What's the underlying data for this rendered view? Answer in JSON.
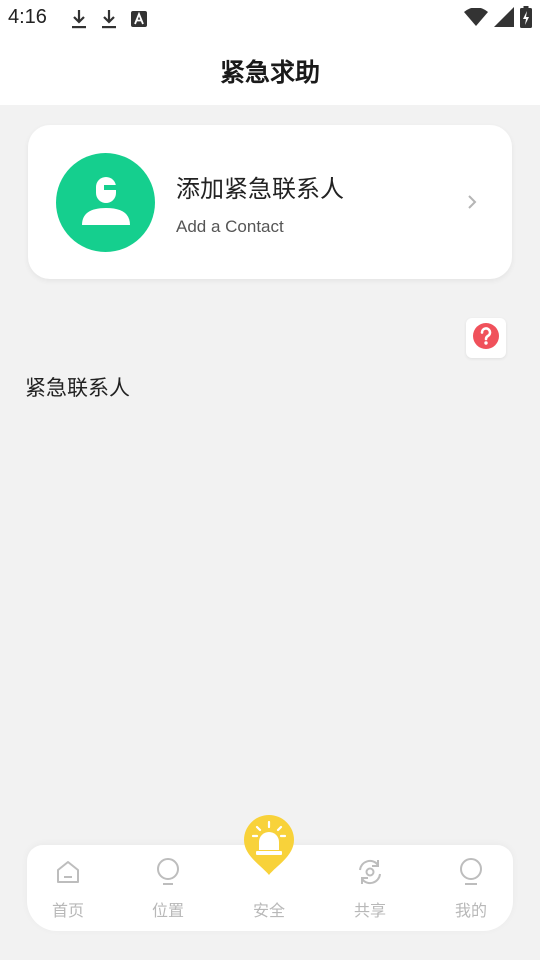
{
  "status_bar": {
    "time": "4:16",
    "left_icons": [
      "download-icon",
      "download-icon",
      "font-a-icon"
    ],
    "right_icons": [
      "wifi-icon",
      "cell-signal-icon",
      "battery-charging-icon"
    ]
  },
  "header": {
    "title": "紧急求助"
  },
  "add_contact_card": {
    "title": "添加紧急联系人",
    "subtitle": "Add a  Contact",
    "avatar_icon": "person-icon",
    "avatar_color": "#15cf8e",
    "chevron_icon": "chevron-right-icon"
  },
  "help": {
    "icon": "question-circle-icon",
    "color": "#f0515b"
  },
  "contacts_section": {
    "label": "紧急联系人"
  },
  "tabbar": {
    "tabs": [
      {
        "label": "首页",
        "icon": "home-icon"
      },
      {
        "label": "位置",
        "icon": "location-pin-icon"
      },
      {
        "label": "安全",
        "icon": "alarm-siren-icon",
        "active": true
      },
      {
        "label": "共享",
        "icon": "share-sync-icon"
      },
      {
        "label": "我的",
        "icon": "user-icon"
      }
    ],
    "active_color": "#f8d23a",
    "inactive_color": "#b8b8b8"
  }
}
